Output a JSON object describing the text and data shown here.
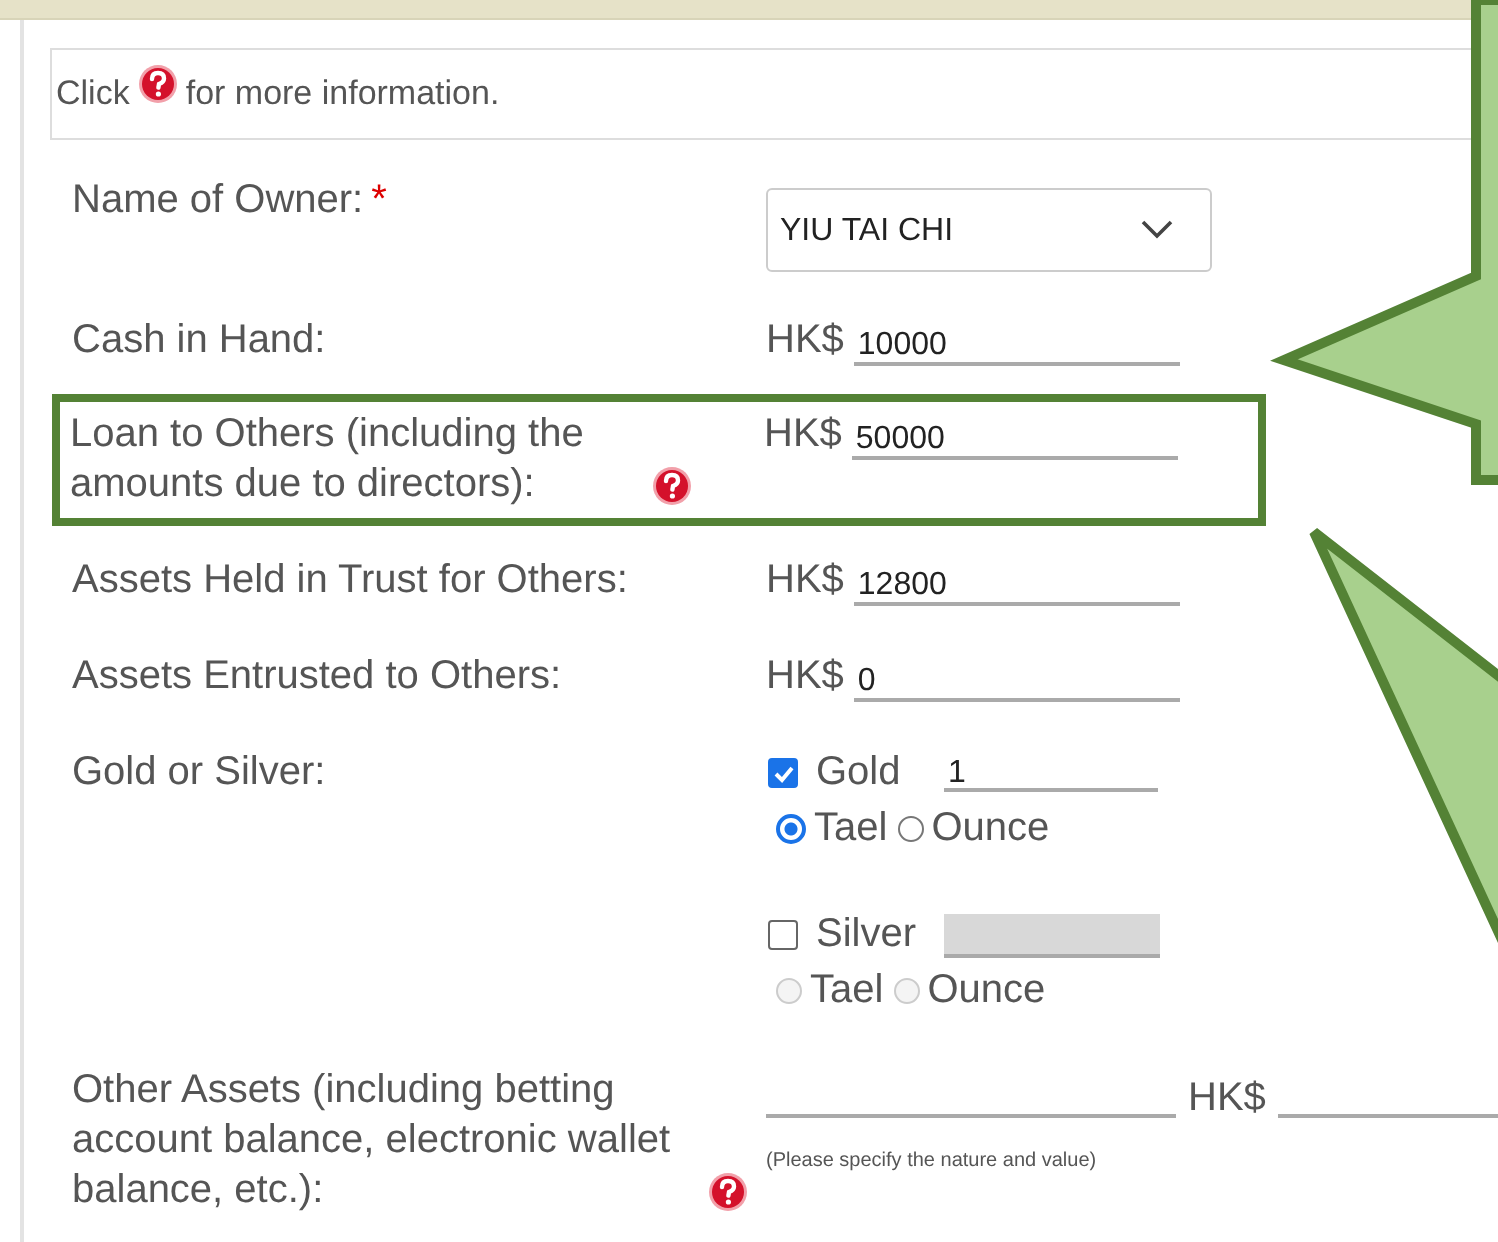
{
  "info": {
    "before": "Click",
    "after": "for more information."
  },
  "fields": [
    {
      "kind": "select",
      "label": "Name of Owner:",
      "required_mark": "*",
      "value": "YIU TAI CHI"
    },
    {
      "kind": "money",
      "label": "Cash in Hand:",
      "currency": "HK$",
      "value": "10000"
    },
    {
      "kind": "money",
      "label": "Loan to Others (including the amounts due to directors):",
      "help": true,
      "highlighted": true,
      "currency": "HK$",
      "value": "50000"
    },
    {
      "kind": "money",
      "label": "Assets Held in Trust for Others:",
      "currency": "HK$",
      "value": "12800"
    },
    {
      "kind": "money",
      "label": "Assets Entrusted to Others:",
      "currency": "HK$",
      "value": "0"
    },
    {
      "kind": "metals",
      "label": "Gold or Silver:",
      "metals": [
        {
          "label": "Gold",
          "checked": true,
          "disabled": false,
          "value": "1",
          "units": [
            {
              "label": "Tael",
              "selected": true
            },
            {
              "label": "Ounce",
              "selected": false
            }
          ]
        },
        {
          "label": "Silver",
          "checked": false,
          "disabled": true,
          "units": [
            {
              "label": "Tael",
              "selected": false
            },
            {
              "label": "Ounce",
              "selected": false
            }
          ]
        }
      ]
    },
    {
      "kind": "other",
      "label": "Other Assets (including betting account balance, electronic wallet balance, etc.):",
      "help": true,
      "hint": "(Please specify the nature and value)",
      "currency": "HK$"
    }
  ]
}
